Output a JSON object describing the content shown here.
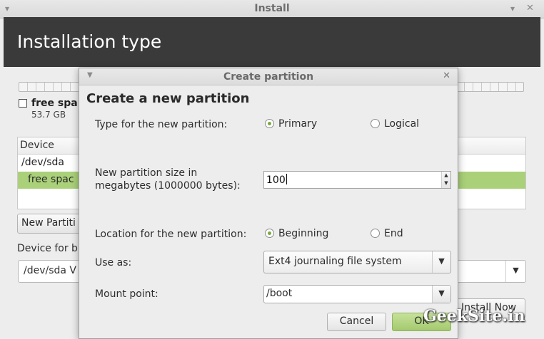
{
  "window": {
    "title": "Install",
    "heading": "Installation type"
  },
  "main": {
    "free_space_label": "free spa",
    "free_space_size": "53.7 GB",
    "table": {
      "header": "Device",
      "rows": [
        "/dev/sda",
        "free spac"
      ]
    },
    "new_partition_button": "New Partiti",
    "device_for_label": "Device for b",
    "device_combo_value": "/dev/sda V",
    "install_now_button": "Install Now"
  },
  "dialog": {
    "title": "Create partition",
    "heading": "Create a new partition",
    "type_label": "Type for the new partition:",
    "type_options": [
      "Primary",
      "Logical"
    ],
    "type_selected": "Primary",
    "size_label_line1": "New partition size in",
    "size_label_line2": "megabytes (1000000 bytes):",
    "size_value": "100",
    "location_label": "Location for the new partition:",
    "location_options": [
      "Beginning",
      "End"
    ],
    "location_selected": "Beginning",
    "use_as_label": "Use as:",
    "use_as_value": "Ext4 journaling file system",
    "mount_label": "Mount point:",
    "mount_value": "/boot",
    "cancel_button": "Cancel",
    "ok_button": "OK"
  },
  "watermark": "GeekSite.in",
  "colors": {
    "header_bg": "#3a3a3a",
    "selection_green": "#aad179",
    "radio_green": "#7aa842"
  },
  "icons": {
    "dialog_menu": "chevron-down-icon",
    "dialog_close": "close-icon",
    "window_menu": "chevron-down-icon",
    "window_close": "close-icon",
    "combo_arrow": "triangle-down-icon",
    "spin_arrows": "spin-arrows-icon"
  }
}
